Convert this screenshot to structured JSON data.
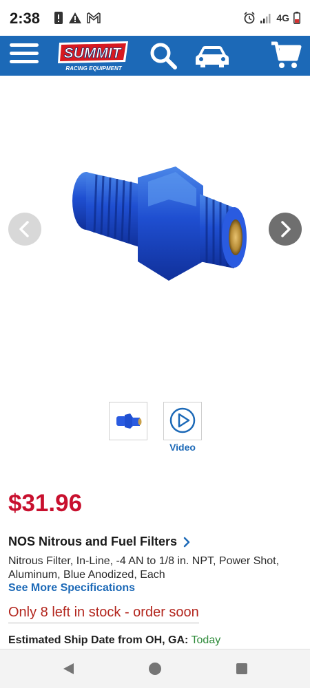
{
  "status_bar": {
    "time": "2:38",
    "network": "4G",
    "icons": [
      "alert-icon",
      "warning-icon",
      "gmail-icon",
      "alarm-icon",
      "signal-icon",
      "battery-icon"
    ]
  },
  "header": {
    "brand": "Summit",
    "brand_sub": "RACING EQUIPMENT",
    "icons": [
      "menu-icon",
      "search-icon",
      "car-icon",
      "cart-icon"
    ],
    "colors": {
      "bar": "#1c69b7",
      "logo_red": "#d71920"
    }
  },
  "gallery": {
    "thumbnails": [
      {
        "kind": "image",
        "icon": "product-thumbnail"
      },
      {
        "kind": "video",
        "icon": "play-icon",
        "label": "Video"
      }
    ]
  },
  "product": {
    "price": "$31.96",
    "category_link": "NOS Nitrous and Fuel Filters",
    "description": "Nitrous Filter, In-Line, -4 AN to 1/8 in. NPT, Power Shot, Aluminum, Blue Anodized, Each",
    "spec_link": "See More Specifications",
    "stock_notice": "Only 8 left in stock - order soon",
    "ship_label": "Estimated Ship Date from OH, GA:",
    "ship_value": "Today",
    "colors": {
      "price": "#c8102e",
      "stock": "#b3261e",
      "ship_value": "#2e8b3a",
      "link": "#1c69b7"
    }
  },
  "nav_bar": {
    "icons": [
      "back-icon",
      "home-icon",
      "recents-icon"
    ]
  }
}
